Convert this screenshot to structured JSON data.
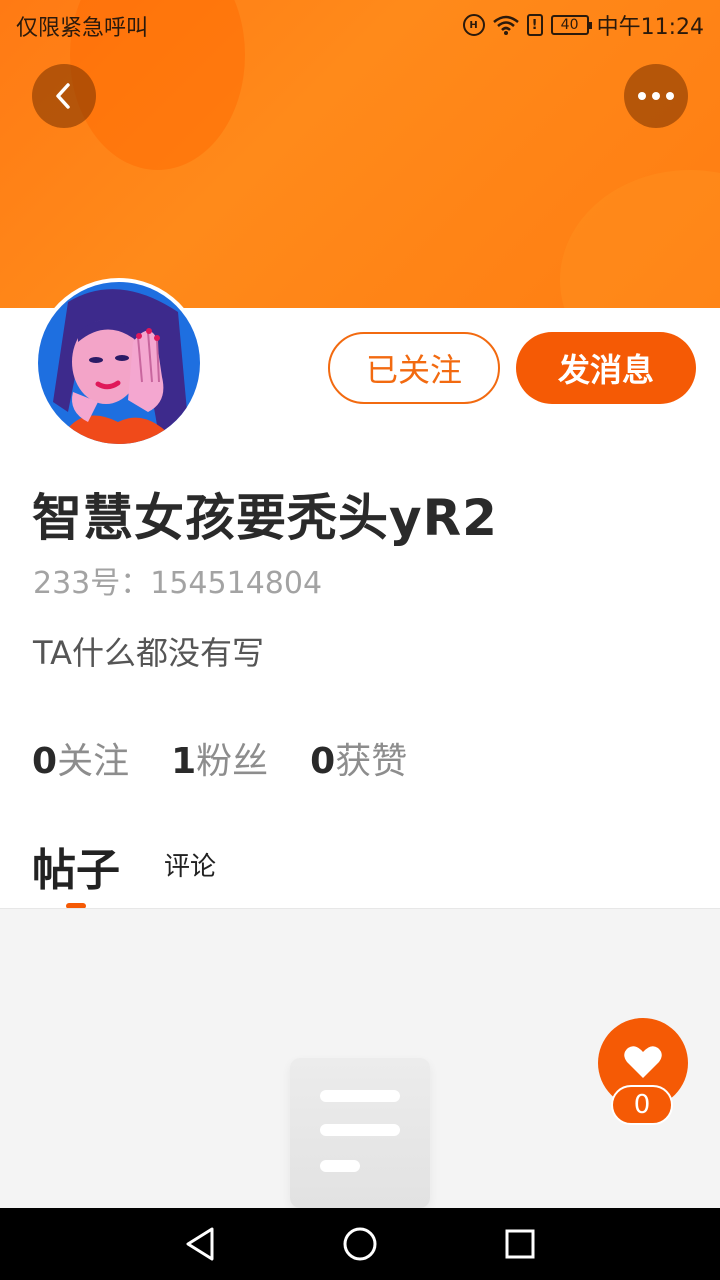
{
  "status_bar": {
    "left_text": "仅限紧急呼叫",
    "battery": "40",
    "time": "中午11:24"
  },
  "header": {
    "back_icon": "chevron-left-icon",
    "more_icon": "more-dots-icon",
    "accent_color": "#f55a05"
  },
  "profile": {
    "username": "智慧女孩要秃头yR2",
    "uid": "233号：154514804",
    "bio": "TA什么都没有写",
    "followed_label": "已关注",
    "message_label": "发消息"
  },
  "stats": [
    {
      "num": "0",
      "label": "关注"
    },
    {
      "num": "1",
      "label": "粉丝"
    },
    {
      "num": "0",
      "label": "获赞"
    }
  ],
  "tabs": {
    "posts": "帖子",
    "comments": "评论"
  },
  "like": {
    "icon": "heart-icon",
    "count": "0"
  },
  "nav": {
    "back": "nav-back-icon",
    "home": "nav-home-icon",
    "recents": "nav-recents-icon"
  }
}
